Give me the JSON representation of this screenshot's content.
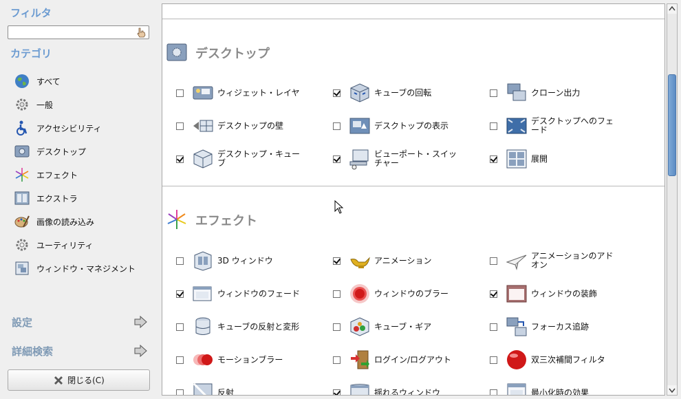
{
  "sidebar": {
    "filter_heading": "フィルタ",
    "filter_value": "",
    "category_heading": "カテゴリ",
    "categories": [
      {
        "label": "すべて",
        "icon": "globe-icon"
      },
      {
        "label": "一般",
        "icon": "gear-icon"
      },
      {
        "label": "アクセシビリティ",
        "icon": "accessibility-icon"
      },
      {
        "label": "デスクトップ",
        "icon": "desktop-icon"
      },
      {
        "label": "エフェクト",
        "icon": "fireworks-icon"
      },
      {
        "label": "エクストラ",
        "icon": "extras-icon"
      },
      {
        "label": "画像の読み込み",
        "icon": "palette-icon"
      },
      {
        "label": "ユーティリティ",
        "icon": "utility-gear-icon"
      },
      {
        "label": "ウィンドウ・マネジメント",
        "icon": "window-management-icon"
      }
    ],
    "settings_label": "設定",
    "advanced_search_label": "詳細検索",
    "close_button": "閉じる(C)"
  },
  "sections": [
    {
      "title": "デスクトップ",
      "icon": "desktop-icon",
      "plugins": [
        {
          "label": "ウィジェット・レイヤ",
          "checked": false,
          "icon": "widget-layer-icon"
        },
        {
          "label": "キューブの回転",
          "checked": true,
          "icon": "cube-rotate-icon"
        },
        {
          "label": "クローン出力",
          "checked": false,
          "icon": "clone-output-icon"
        },
        {
          "label": "デスクトップの壁",
          "checked": false,
          "icon": "desktop-wall-icon"
        },
        {
          "label": "デスクトップの表示",
          "checked": false,
          "icon": "show-desktop-icon"
        },
        {
          "label": "デスクトップへのフェード",
          "checked": false,
          "icon": "fade-desktop-icon"
        },
        {
          "label": "デスクトップ・キューブ",
          "checked": true,
          "icon": "desktop-cube-icon"
        },
        {
          "label": "ビューポート・スイッチャー",
          "checked": true,
          "icon": "viewport-switcher-icon"
        },
        {
          "label": "展開",
          "checked": true,
          "icon": "expo-icon"
        }
      ]
    },
    {
      "title": "エフェクト",
      "icon": "fireworks-icon",
      "plugins": [
        {
          "label": "3D ウィンドウ",
          "checked": false,
          "icon": "3d-windows-icon"
        },
        {
          "label": "アニメーション",
          "checked": true,
          "icon": "genie-lamp-icon"
        },
        {
          "label": "アニメーションのアドオン",
          "checked": false,
          "icon": "paper-plane-icon"
        },
        {
          "label": "ウィンドウのフェード",
          "checked": true,
          "icon": "fade-windows-icon"
        },
        {
          "label": "ウィンドウのブラー",
          "checked": false,
          "icon": "blur-windows-icon"
        },
        {
          "label": "ウィンドウの装飾",
          "checked": true,
          "icon": "window-decoration-icon"
        },
        {
          "label": "キューブの反射と変形",
          "checked": false,
          "icon": "cube-reflection-icon"
        },
        {
          "label": "キューブ・ギア",
          "checked": false,
          "icon": "cube-gears-icon"
        },
        {
          "label": "フォーカス追跡",
          "checked": false,
          "icon": "focus-tracking-icon"
        },
        {
          "label": "モーションブラー",
          "checked": false,
          "icon": "motion-blur-icon"
        },
        {
          "label": "ログイン/ログアウト",
          "checked": false,
          "icon": "login-logout-icon"
        },
        {
          "label": "双三次補間フィルタ",
          "checked": false,
          "icon": "bicubic-filter-icon"
        },
        {
          "label": "反射",
          "checked": false,
          "icon": "reflection-icon"
        },
        {
          "label": "揺れるウィンドウ",
          "checked": true,
          "icon": "wobbly-windows-icon"
        },
        {
          "label": "最小化時の効果",
          "checked": false,
          "icon": "minimize-effect-icon"
        }
      ]
    }
  ],
  "colors": {
    "heading_blue": "#6b9bd1",
    "section_gray": "#8a8a8a",
    "scroll_thumb": "#6b99cd"
  }
}
